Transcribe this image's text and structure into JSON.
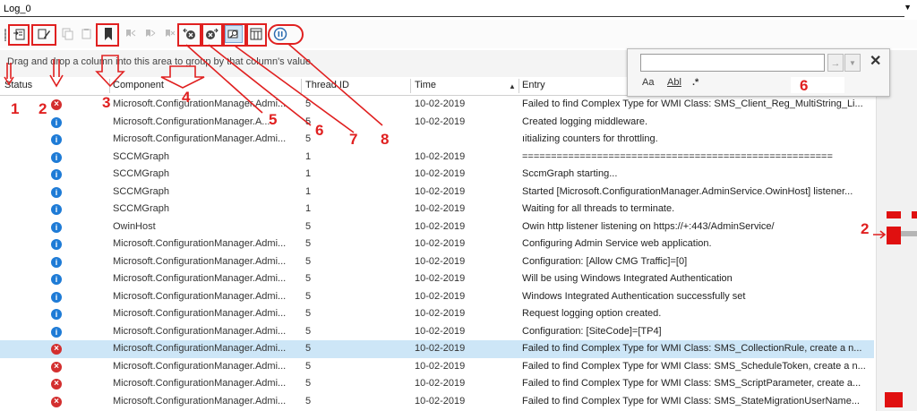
{
  "tab": {
    "label": "Log_0"
  },
  "group_area": {
    "text": "Drag and drop a column into this area to group by that column's value."
  },
  "columns": {
    "status": "Status",
    "component": "Component",
    "thread": "Thread ID",
    "time": "Time",
    "entry": "Entry"
  },
  "rows": [
    {
      "status": "error",
      "component": "Microsoft.ConfigurationManager.Admi...",
      "thread": "5",
      "time": "10-02-2019",
      "entry": "Failed to find Complex Type for WMI Class: SMS_Client_Reg_MultiString_Li..."
    },
    {
      "status": "info",
      "component": "Microsoft.ConfigurationManager.A...",
      "thread": "5",
      "time": "10-02-2019",
      "entry": "Created logging middleware."
    },
    {
      "status": "info",
      "component": "Microsoft.ConfigurationManager.Admi...",
      "thread": "5",
      "time": "",
      "entry": "ıitializing counters for throttling."
    },
    {
      "status": "info",
      "component": "SCCMGraph",
      "thread": "1",
      "time": "10-02-2019",
      "entry": "======================================================"
    },
    {
      "status": "info",
      "component": "SCCMGraph",
      "thread": "1",
      "time": "10-02-2019",
      "entry": "SccmGraph starting..."
    },
    {
      "status": "info",
      "component": "SCCMGraph",
      "thread": "1",
      "time": "10-02-2019",
      "entry": "Started [Microsoft.ConfigurationManager.AdminService.OwinHost] listener..."
    },
    {
      "status": "info",
      "component": "SCCMGraph",
      "thread": "1",
      "time": "10-02-2019",
      "entry": "Waiting for all threads to terminate."
    },
    {
      "status": "info",
      "component": "OwinHost",
      "thread": "5",
      "time": "10-02-2019",
      "entry": "Owin http listener listening on https://+:443/AdminService/"
    },
    {
      "status": "info",
      "component": "Microsoft.ConfigurationManager.Admi...",
      "thread": "5",
      "time": "10-02-2019",
      "entry": "Configuring Admin Service web application."
    },
    {
      "status": "info",
      "component": "Microsoft.ConfigurationManager.Admi...",
      "thread": "5",
      "time": "10-02-2019",
      "entry": "Configuration: [Allow CMG Traffic]=[0]"
    },
    {
      "status": "info",
      "component": "Microsoft.ConfigurationManager.Admi...",
      "thread": "5",
      "time": "10-02-2019",
      "entry": "Will be using Windows Integrated Authentication"
    },
    {
      "status": "info",
      "component": "Microsoft.ConfigurationManager.Admi...",
      "thread": "5",
      "time": "10-02-2019",
      "entry": "Windows Integrated Authentication successfully set"
    },
    {
      "status": "info",
      "component": "Microsoft.ConfigurationManager.Admi...",
      "thread": "5",
      "time": "10-02-2019",
      "entry": "Request logging option created."
    },
    {
      "status": "info",
      "component": "Microsoft.ConfigurationManager.Admi...",
      "thread": "5",
      "time": "10-02-2019",
      "entry": "Configuration: [SiteCode]=[TP4]"
    },
    {
      "status": "error",
      "component": "Microsoft.ConfigurationManager.Admi...",
      "thread": "5",
      "time": "10-02-2019",
      "entry": "Failed to find Complex Type for WMI Class: SMS_CollectionRule, create a n...",
      "selected": true
    },
    {
      "status": "error",
      "component": "Microsoft.ConfigurationManager.Admi...",
      "thread": "5",
      "time": "10-02-2019",
      "entry": "Failed to find Complex Type for WMI Class: SMS_ScheduleToken, create a n..."
    },
    {
      "status": "error",
      "component": "Microsoft.ConfigurationManager.Admi...",
      "thread": "5",
      "time": "10-02-2019",
      "entry": "Failed to find Complex Type for WMI Class: SMS_ScriptParameter, create a..."
    },
    {
      "status": "error",
      "component": "Microsoft.ConfigurationManager.Admi...",
      "thread": "5",
      "time": "10-02-2019",
      "entry": "Failed to find Complex Type for WMI Class: SMS_StateMigrationUserName..."
    }
  ],
  "find_panel": {
    "value": "",
    "opt_case": "Aa",
    "opt_word": "Abl",
    "opt_regex": ".*"
  },
  "annotations": [
    "1",
    "2",
    "3",
    "4",
    "5",
    "6",
    "7",
    "8",
    "6",
    "2"
  ],
  "icons": {
    "toolbar": [
      "open-log-icon",
      "highlight-icon",
      "copy-icon",
      "paste-icon",
      "bookmark-icon",
      "prev-bookmark-icon",
      "next-bookmark-icon",
      "clear-bookmarks-icon",
      "previous-error-icon",
      "next-error-icon",
      "find-icon",
      "columns-icon",
      "pause-icon"
    ],
    "find": [
      "find-next-icon",
      "find-options-icon",
      "close-icon"
    ]
  },
  "colors": {
    "info": "#1e7bd6",
    "error": "#d32f2f",
    "annotation": "#e02020",
    "selected_row": "#cde6f7"
  }
}
